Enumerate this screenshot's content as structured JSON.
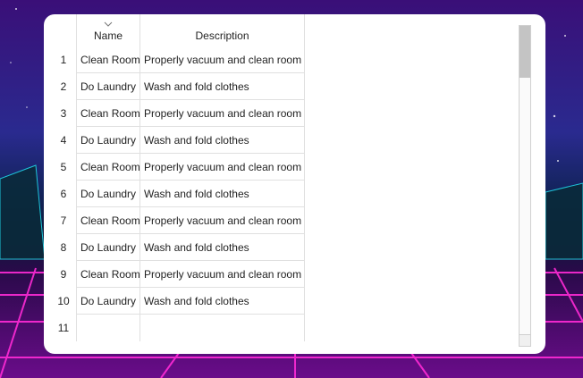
{
  "table": {
    "columns": {
      "name": "Name",
      "description": "Description"
    },
    "rows": [
      {
        "num": "1",
        "name": "Clean Room",
        "description": "Properly vacuum and clean room"
      },
      {
        "num": "2",
        "name": "Do Laundry",
        "description": "Wash and fold clothes"
      },
      {
        "num": "3",
        "name": "Clean Room",
        "description": "Properly vacuum and clean room"
      },
      {
        "num": "4",
        "name": "Do Laundry",
        "description": "Wash and fold clothes"
      },
      {
        "num": "5",
        "name": "Clean Room",
        "description": "Properly vacuum and clean room"
      },
      {
        "num": "6",
        "name": "Do Laundry",
        "description": "Wash and fold clothes"
      },
      {
        "num": "7",
        "name": "Clean Room",
        "description": "Properly vacuum and clean room"
      },
      {
        "num": "8",
        "name": "Do Laundry",
        "description": "Wash and fold clothes"
      },
      {
        "num": "9",
        "name": "Clean Room",
        "description": "Properly vacuum and clean room"
      },
      {
        "num": "10",
        "name": "Do Laundry",
        "description": "Wash and fold clothes"
      },
      {
        "num": "11",
        "name": "",
        "description": ""
      }
    ],
    "sort_icon": "chevron-down-icon"
  },
  "colors": {
    "card_background": "#ffffff",
    "gridline": "#e0e0e0",
    "scroll_thumb": "#c4c4c4"
  }
}
